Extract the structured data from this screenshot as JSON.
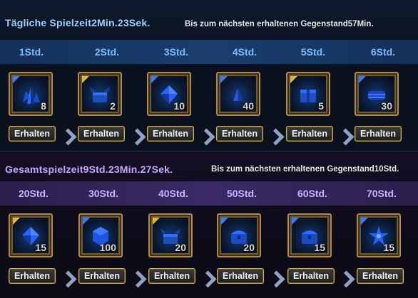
{
  "daily": {
    "title": "Tägliche Spielzeit2Min.23Sek.",
    "next_info": "Bis zum nächsten erhaltenen Gegenstand57Min.",
    "slots": [
      {
        "time": "1Std.",
        "qty": "8",
        "button": "Erhalten",
        "corner": "blue",
        "icon": "blue-crystal-cluster-icon"
      },
      {
        "time": "2Std.",
        "qty": "2",
        "button": "Erhalten",
        "corner": "gold",
        "icon": "treasure-chest-wings-icon"
      },
      {
        "time": "3Std.",
        "qty": "10",
        "button": "Erhalten",
        "corner": "blue",
        "icon": "blue-gem-icon"
      },
      {
        "time": "4Std.",
        "qty": "40",
        "button": "Erhalten",
        "corner": "blue",
        "icon": "blue-shard-icon"
      },
      {
        "time": "5Std.",
        "qty": "5",
        "button": "Erhalten",
        "corner": "gold",
        "icon": "blue-box-icon"
      },
      {
        "time": "6Std.",
        "qty": "30",
        "button": "Erhalten",
        "corner": "blue",
        "icon": "blue-scroll-icon"
      }
    ]
  },
  "total": {
    "title": "Gesamtspielzeit9Std.23Min.27Sek.",
    "next_info": "Bis zum nächsten erhaltenen Gegenstand10Std.",
    "slots": [
      {
        "time": "20Std.",
        "qty": "15",
        "button": "Erhalten",
        "corner": "gold",
        "icon": "blue-gem-icon"
      },
      {
        "time": "30Std.",
        "qty": "100",
        "button": "Erhalten",
        "corner": "blue",
        "icon": "blue-hex-crystal-icon"
      },
      {
        "time": "40Std.",
        "qty": "20",
        "button": "Erhalten",
        "corner": "gold",
        "icon": "treasure-chest-wings-icon"
      },
      {
        "time": "50Std.",
        "qty": "20",
        "button": "Erhalten",
        "corner": "blue",
        "icon": "blue-chest-icon"
      },
      {
        "time": "60Std.",
        "qty": "15",
        "button": "Erhalten",
        "corner": "blue",
        "icon": "blue-chest-icon"
      },
      {
        "time": "70Std.",
        "qty": "15",
        "button": "Erhalten",
        "corner": "blue",
        "icon": "blue-star-gem-icon"
      }
    ]
  }
}
